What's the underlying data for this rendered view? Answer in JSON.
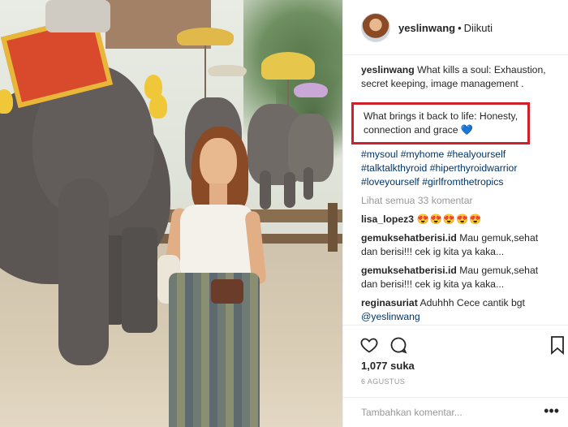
{
  "post": {
    "username": "yeslinwang",
    "separator": "•",
    "follow_status": "Diikuti"
  },
  "caption": {
    "user": "yeslinwang",
    "line1": "What kills a soul: Exhaustion, secret keeping, image management .",
    "highlight": "What brings it back to life: Honesty, connection and grace 💙",
    "hashtags": [
      "#mysoul",
      "#myhome",
      "#healyourself",
      "#talktalkthyroid",
      "#hiperthyroidwarrior",
      "#loveyourself",
      "#girlfromthetropics"
    ]
  },
  "view_all": "Lihat semua 33 komentar",
  "comments": [
    {
      "user": "lisa_lopez3",
      "text": "😍😍😍😍😍"
    },
    {
      "user": "gemuksehatberisi.id",
      "text": "Mau gemuk,sehat dan berisi!!! cek ig kita ya kaka..."
    },
    {
      "user": "gemuksehatberisi.id",
      "text": "Mau gemuk,sehat dan berisi!!! cek ig kita ya kaka..."
    },
    {
      "user": "reginasuriat",
      "text": "Aduhhh Cece cantik bgt",
      "mention": "@yeslinwang"
    }
  ],
  "likes": "1,077 suka",
  "date": "6 AGUSTUS",
  "add_comment_placeholder": "Tambahkan komentar...",
  "more_options": "•••",
  "icons": {
    "heart": "heart-icon",
    "comment": "comment-icon",
    "bookmark": "bookmark-icon"
  },
  "colors": {
    "highlight_border": "#d0202a",
    "hashtag": "#003569",
    "muted": "#999999"
  }
}
